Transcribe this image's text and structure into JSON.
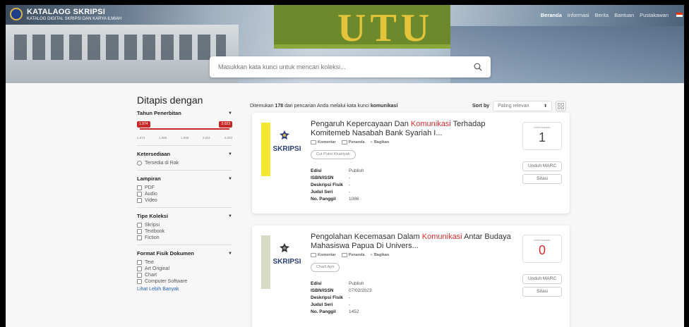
{
  "header": {
    "brand_title": "KATALAOG SKRIPSI",
    "brand_subtitle": "KATALOG DIGITAL SKRIPSI DAN KARYA ILMIAH",
    "nav": [
      "Beranda",
      "Informasi",
      "Berita",
      "Bantuan",
      "Pustakawan"
    ]
  },
  "search": {
    "placeholder": "Masukkan kata kunci untuk mencari koleksi..."
  },
  "sidebar": {
    "title": "Ditapis dengan",
    "year": {
      "label": "Tahun Penerbitan",
      "range_min": "1.974",
      "range_max": "2.023",
      "ticks": [
        "1.974",
        "1.986",
        "1.998",
        "2.011",
        "2.023"
      ]
    },
    "availability": {
      "label": "Ketersediaan",
      "options": [
        "Tersedia di Rak"
      ]
    },
    "attachment": {
      "label": "Lampiran",
      "options": [
        "PDF",
        "Audio",
        "Video"
      ]
    },
    "collection_type": {
      "label": "Tipe Koleksi",
      "options": [
        "Skripsi",
        "Textbook",
        "Fiction"
      ]
    },
    "physical_format": {
      "label": "Format Fisik Dokumen",
      "options": [
        "Text",
        "Art Original",
        "Chart",
        "Computer Software"
      ],
      "more_link": "Lihat Lebih Banyak"
    }
  },
  "results": {
    "summary_prefix": "Ditemukan",
    "count": "178",
    "summary_middle": "dari pencarian Anda melalui kata kunci",
    "keyword": "komunikasi",
    "sort_label": "Sort by",
    "sort_value": "Paling relevan"
  },
  "card_common": {
    "cover_label": "SKRIPSI",
    "comment": "Komentar",
    "bookmark": "Penanda",
    "share": "Bagikan",
    "availability_label": "Ketersediaan",
    "marc_button": "Unduh MARC",
    "cite_button": "Sitasi",
    "meta_keys": [
      "Edisi",
      "ISBN/ISSN",
      "Deskripsi Fisik",
      "Judul Seri",
      "No. Panggil"
    ]
  },
  "cards": [
    {
      "title_before": "Pengaruh Kepercayaan Dan ",
      "title_highlight": "Komunikasi",
      "title_after": " Terhadap Komitemeb Nasabah Bank Syariah I...",
      "author": "Cut Putro Khairiyah",
      "availability": "1",
      "meta_values": [
        "Publish",
        "-",
        "-",
        "-",
        "1086"
      ]
    },
    {
      "title_before": "Pengolahan Kecemasan Dalam ",
      "title_highlight": "Komunikasi",
      "title_after": " Antar Budaya Mahasiswa Papua Di Univers...",
      "author": "Charli Apri",
      "availability": "0",
      "meta_values": [
        "Publish",
        "07/02/2023",
        "-",
        "-",
        "1452"
      ]
    }
  ],
  "colors": {
    "accent_red": "#d32f2f",
    "cover_yellow": "#f3e733",
    "link_blue": "#2563b0"
  }
}
